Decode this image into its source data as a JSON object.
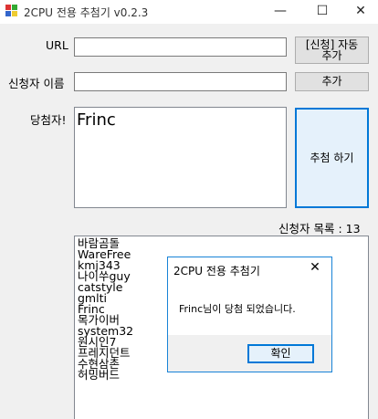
{
  "window": {
    "title": "2CPU 전용 추첨기 v0.2.3",
    "minimize": "—",
    "maximize": "☐",
    "close": "✕"
  },
  "form": {
    "url_label": "URL",
    "url_value": "",
    "auto_add_label_line1": "[신청] 자동",
    "auto_add_label_line2": "추가",
    "name_label": "신청자 이름",
    "name_value": "",
    "add_label": "추가",
    "winner_label": "당첨자!",
    "winner_value": "Frinc",
    "draw_label": "추첨 하기",
    "count_label": "신청자 목록 : 13"
  },
  "applicants": [
    "바람곰돌",
    "WareFree",
    "kmj343",
    "나이쑤guy",
    "catstyle",
    "gmlti",
    "Frinc",
    "목가이버",
    "system32",
    "원시인7",
    "프레지던트",
    "수현삼촌",
    "허밍버드"
  ],
  "dialog": {
    "title": "2CPU 전용 추첨기",
    "close": "✕",
    "message": "Frinc님이 당첨 되었습니다.",
    "ok_label": "확인"
  },
  "colors": {
    "accent": "#0078d7",
    "dialog_border": "#1883d7"
  }
}
